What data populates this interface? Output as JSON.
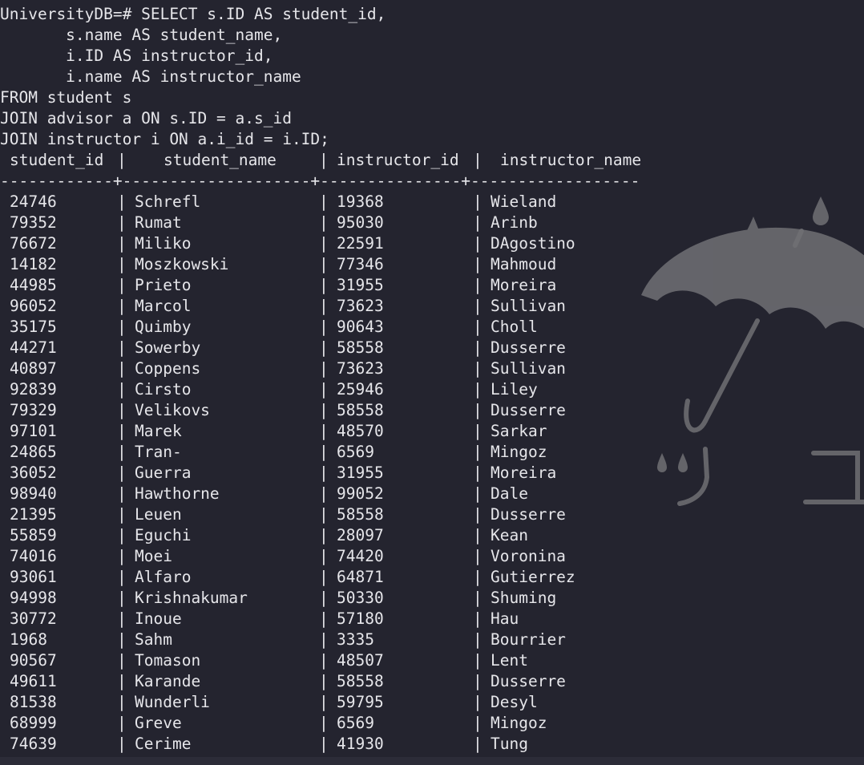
{
  "query_lines": [
    "UniversityDB=# SELECT s.ID AS student_id,",
    "       s.name AS student_name,",
    "       i.ID AS instructor_id,",
    "       i.name AS instructor_name",
    "FROM student s",
    "JOIN advisor a ON s.ID = a.s_id",
    "JOIN instructor i ON a.i_id = i.ID;"
  ],
  "table": {
    "headers": [
      "student_id",
      "student_name",
      "instructor_id",
      "instructor_name"
    ],
    "divider": "------------+--------------------+---------------+------------------",
    "separator": "|",
    "rows": [
      [
        "24746",
        "Schrefl",
        "19368",
        "Wieland"
      ],
      [
        "79352",
        "Rumat",
        "95030",
        "Arinb"
      ],
      [
        "76672",
        "Miliko",
        "22591",
        "DAgostino"
      ],
      [
        "14182",
        "Moszkowski",
        "77346",
        "Mahmoud"
      ],
      [
        "44985",
        "Prieto",
        "31955",
        "Moreira"
      ],
      [
        "96052",
        "Marcol",
        "73623",
        "Sullivan"
      ],
      [
        "35175",
        "Quimby",
        "90643",
        "Choll"
      ],
      [
        "44271",
        "Sowerby",
        "58558",
        "Dusserre"
      ],
      [
        "40897",
        "Coppens",
        "73623",
        "Sullivan"
      ],
      [
        "92839",
        "Cirsto",
        "25946",
        "Liley"
      ],
      [
        "79329",
        "Velikovs",
        "58558",
        "Dusserre"
      ],
      [
        "97101",
        "Marek",
        "48570",
        "Sarkar"
      ],
      [
        "24865",
        "Tran-",
        "6569",
        "Mingoz"
      ],
      [
        "36052",
        "Guerra",
        "31955",
        "Moreira"
      ],
      [
        "98940",
        "Hawthorne",
        "99052",
        "Dale"
      ],
      [
        "21395",
        "Leuen",
        "58558",
        "Dusserre"
      ],
      [
        "55859",
        "Eguchi",
        "28097",
        "Kean"
      ],
      [
        "74016",
        "Moei",
        "74420",
        "Voronina"
      ],
      [
        "93061",
        "Alfaro",
        "64871",
        "Gutierrez"
      ],
      [
        "94998",
        "Krishnakumar",
        "50330",
        "Shuming"
      ],
      [
        "30772",
        "Inoue",
        "57180",
        "Hau"
      ],
      [
        "1968",
        "Sahm",
        "3335",
        "Bourrier"
      ],
      [
        "90567",
        "Tomason",
        "48507",
        "Lent"
      ],
      [
        "49611",
        "Karande",
        "58558",
        "Dusserre"
      ],
      [
        "81538",
        "Wunderli",
        "59795",
        "Desyl"
      ],
      [
        "68999",
        "Greve",
        "6569",
        "Mingoz"
      ],
      [
        "74639",
        "Cerime",
        "41930",
        "Tung"
      ]
    ]
  },
  "wallpaper": {
    "icon": "umbrella-rain-icon",
    "kana_left": "ツ",
    "kana_right": "ユ",
    "color": "#6b6b70"
  },
  "colors": {
    "background": "#24242f",
    "text": "#e6e6ea"
  }
}
